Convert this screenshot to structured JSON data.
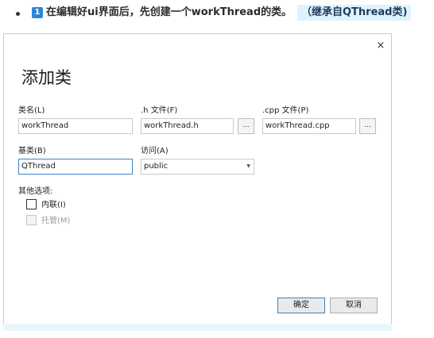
{
  "instruction": {
    "step_number": "1",
    "text": "在编辑好ui界面后，先创建一个workThread的类。",
    "highlight": "（继承自QThread类)"
  },
  "dialog": {
    "title": "添加类",
    "close_glyph": "×",
    "class_name": {
      "label": "类名(L)",
      "value": "workThread"
    },
    "h_file": {
      "label": ".h 文件(F)",
      "value": "workThread.h",
      "browse_label": "..."
    },
    "cpp_file": {
      "label": ".cpp 文件(P)",
      "value": "workThread.cpp",
      "browse_label": "..."
    },
    "base_class": {
      "label": "基类(B)",
      "value": "QThread"
    },
    "access": {
      "label": "访问(A)",
      "value": "public"
    },
    "other_options": {
      "label": "其他选项:",
      "inline": {
        "label": "内联(I)",
        "checked": false,
        "enabled": true
      },
      "managed": {
        "label": "托管(M)",
        "checked": false,
        "enabled": false
      }
    },
    "ok_label": "确定",
    "cancel_label": "取消"
  }
}
